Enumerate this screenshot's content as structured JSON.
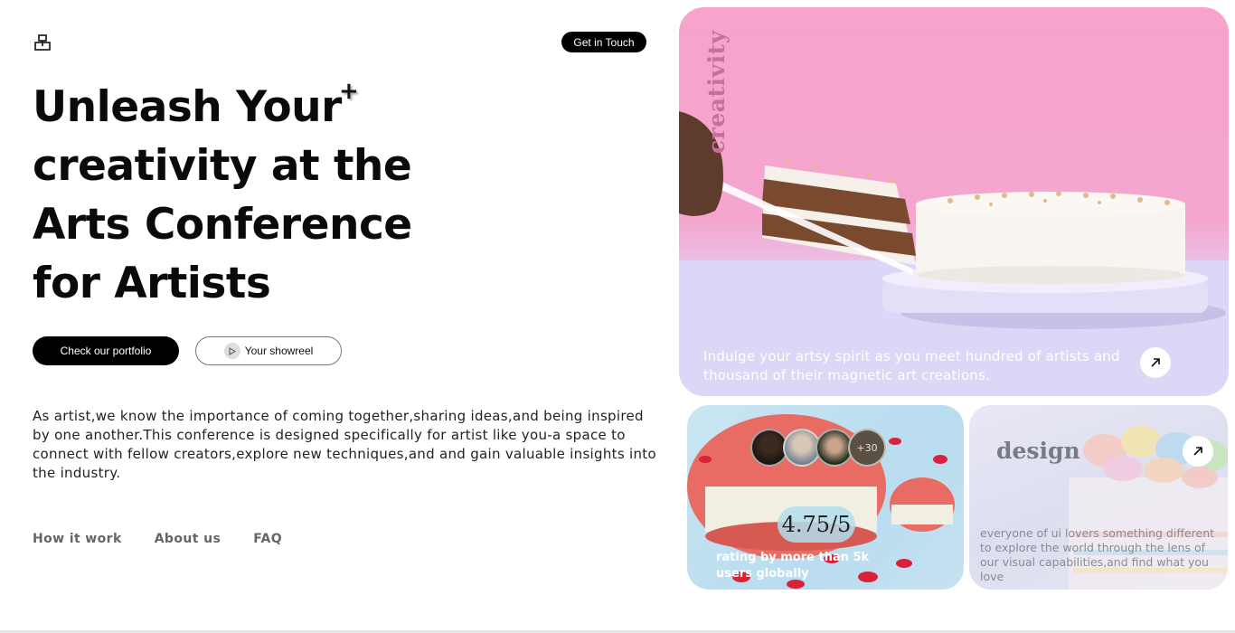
{
  "header": {
    "logo_icon": "stacked-boxes-icon",
    "get_in_touch_label": "Get in Touch"
  },
  "hero": {
    "headline_lines": [
      "Unleash Your",
      "creativity at the",
      "Arts Conference",
      "for Artists"
    ],
    "plus_symbol": "+",
    "portfolio_button_label": "Check our portfolio",
    "showreel_button_label": "Your showreel",
    "showreel_icon": "play-icon",
    "intro_text": "As artist,we know the importance of coming together,sharing ideas,and being inspired by one another.This conference is designed specifically for artist like you-a space to connect with fellow creators,explore new techniques,and and gain valuable insights into the industry."
  },
  "footer_nav": {
    "items": [
      {
        "label": "How it work"
      },
      {
        "label": "About us"
      },
      {
        "label": "FAQ"
      }
    ]
  },
  "cards": {
    "hero_card": {
      "vertical_label": "creativity",
      "caption": "Indulge your artsy spirit as you meet hundred of artists and thousand of their magnetic art creations.",
      "arrow_icon": "arrow-up-right-icon"
    },
    "rating_card": {
      "avatar_count": "+30",
      "rating": "4.75/5",
      "caption": "rating by more than 5k users globally"
    },
    "design_card": {
      "title": "design",
      "caption": "everyone of ui lovers something different to explore the world through the lens of our visual capabilities,and find what you love",
      "arrow_icon": "arrow-up-right-icon"
    }
  },
  "colors": {
    "primary": "#000000",
    "background": "#ffffff",
    "hero_pink": "#f4a6cf",
    "rating_blue": "#b9dcef",
    "design_lavender": "#dcdff0"
  }
}
